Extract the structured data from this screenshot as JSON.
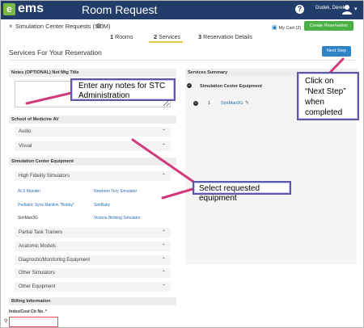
{
  "topbar": {
    "logo_text": "ems",
    "logo_letter": "e",
    "app_title": "Room Request",
    "help_glyph": "?",
    "user_name": "Dudek, Derek",
    "caret": "▾"
  },
  "request": {
    "close_glyph": "×",
    "title": "Simulation Center Requests (SOM)",
    "info_glyph": "i",
    "cart_label": "My Cart (2)",
    "create_label": "Create Reservation"
  },
  "steps": [
    {
      "num": "1",
      "label": "Rooms"
    },
    {
      "num": "2",
      "label": "Services"
    },
    {
      "num": "3",
      "label": "Reservation Details"
    }
  ],
  "section_title": "Services For Your Reservation",
  "next_step_label": "Next Step",
  "notes": {
    "header": "Notes (OPTIONAL) Not Mtg Title",
    "value": ""
  },
  "school_av": {
    "header": "School of Medicine AV",
    "items": [
      "Audio",
      "Visual"
    ]
  },
  "sim_equipment": {
    "header": "Simulation Center Equipment",
    "open_group": "High Fidelity Simulators",
    "items": [
      {
        "name": "ALS Manikin",
        "selected": false
      },
      {
        "name": "Newborn Tory Simulator",
        "selected": false
      },
      {
        "name": "Pediatric Syris Manikin \"Bobby\"",
        "selected": false
      },
      {
        "name": "SimBaby",
        "selected": false
      },
      {
        "name": "SimMan3G",
        "selected": true
      },
      {
        "name": "Victoria Birthing Simulator",
        "selected": false
      }
    ],
    "closed_groups": [
      "Partial Task Trainers",
      "Anatomic Models",
      "Diagnostic/Monitoring Equipment",
      "Other Simulators",
      "Other Equipment"
    ]
  },
  "billing": {
    "header": "Billing Information",
    "cost_label": "Index/Cost Ctr No. *",
    "cost_value": ""
  },
  "summary": {
    "header": "Services Summary",
    "group": "Simulation Center Equipment",
    "rows": [
      {
        "qty": "1",
        "item": "SimMan3G"
      }
    ]
  },
  "annotations": {
    "notes": "Enter any notes for STC Administration",
    "next_lines": [
      "Click on",
      "“Next Step”",
      "when",
      "completed"
    ],
    "select": "Select requested equipment"
  },
  "glyphs": {
    "chevron_up": "⌃",
    "minus": "−",
    "pencil": "✎",
    "search": "⚲",
    "cart": "🛒"
  },
  "colors": {
    "topbar": "#233d6b",
    "logo": "#7ab648",
    "create": "#4bb045",
    "next": "#2e83c6",
    "link": "#2a6db5",
    "callout_border": "#5c58a6",
    "arrow": "#d03a7a",
    "required_border": "#e24b5b"
  }
}
